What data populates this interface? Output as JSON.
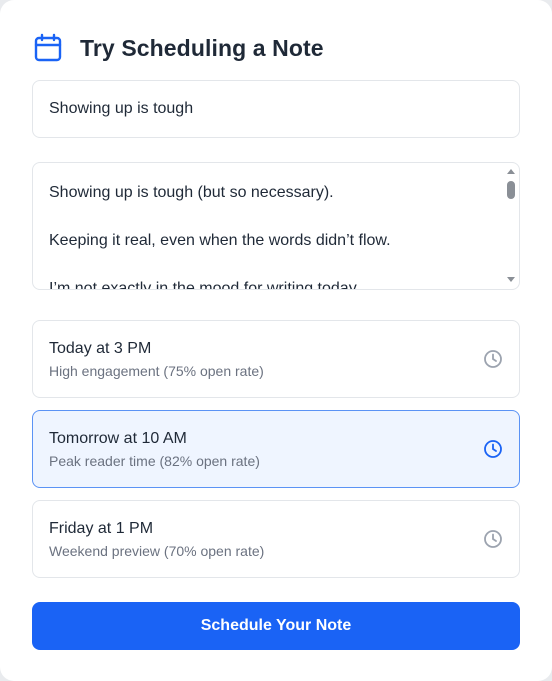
{
  "header": {
    "title": "Try Scheduling a Note",
    "icon": "calendar-icon"
  },
  "note_title": {
    "value": "Showing up is tough"
  },
  "note_body": {
    "lines": [
      "Showing up is tough (but so necessary).",
      "Keeping it real, even when the words didn’t flow.",
      "I’m not exactly in the mood for writing today."
    ]
  },
  "slots": [
    {
      "title": "Today at 3 PM",
      "subtitle": "High engagement (75% open rate)",
      "selected": false,
      "icon": "clock-icon"
    },
    {
      "title": "Tomorrow at 10 AM",
      "subtitle": "Peak reader time (82% open rate)",
      "selected": true,
      "icon": "clock-icon"
    },
    {
      "title": "Friday at 1 PM",
      "subtitle": "Weekend preview (70% open rate)",
      "selected": false,
      "icon": "clock-icon"
    }
  ],
  "cta": {
    "label": "Schedule Your Note"
  },
  "colors": {
    "accent": "#1a63f5",
    "selected_bg": "#eff5ff",
    "selected_border": "#5b93f5",
    "icon_muted": "#9ca3af"
  }
}
